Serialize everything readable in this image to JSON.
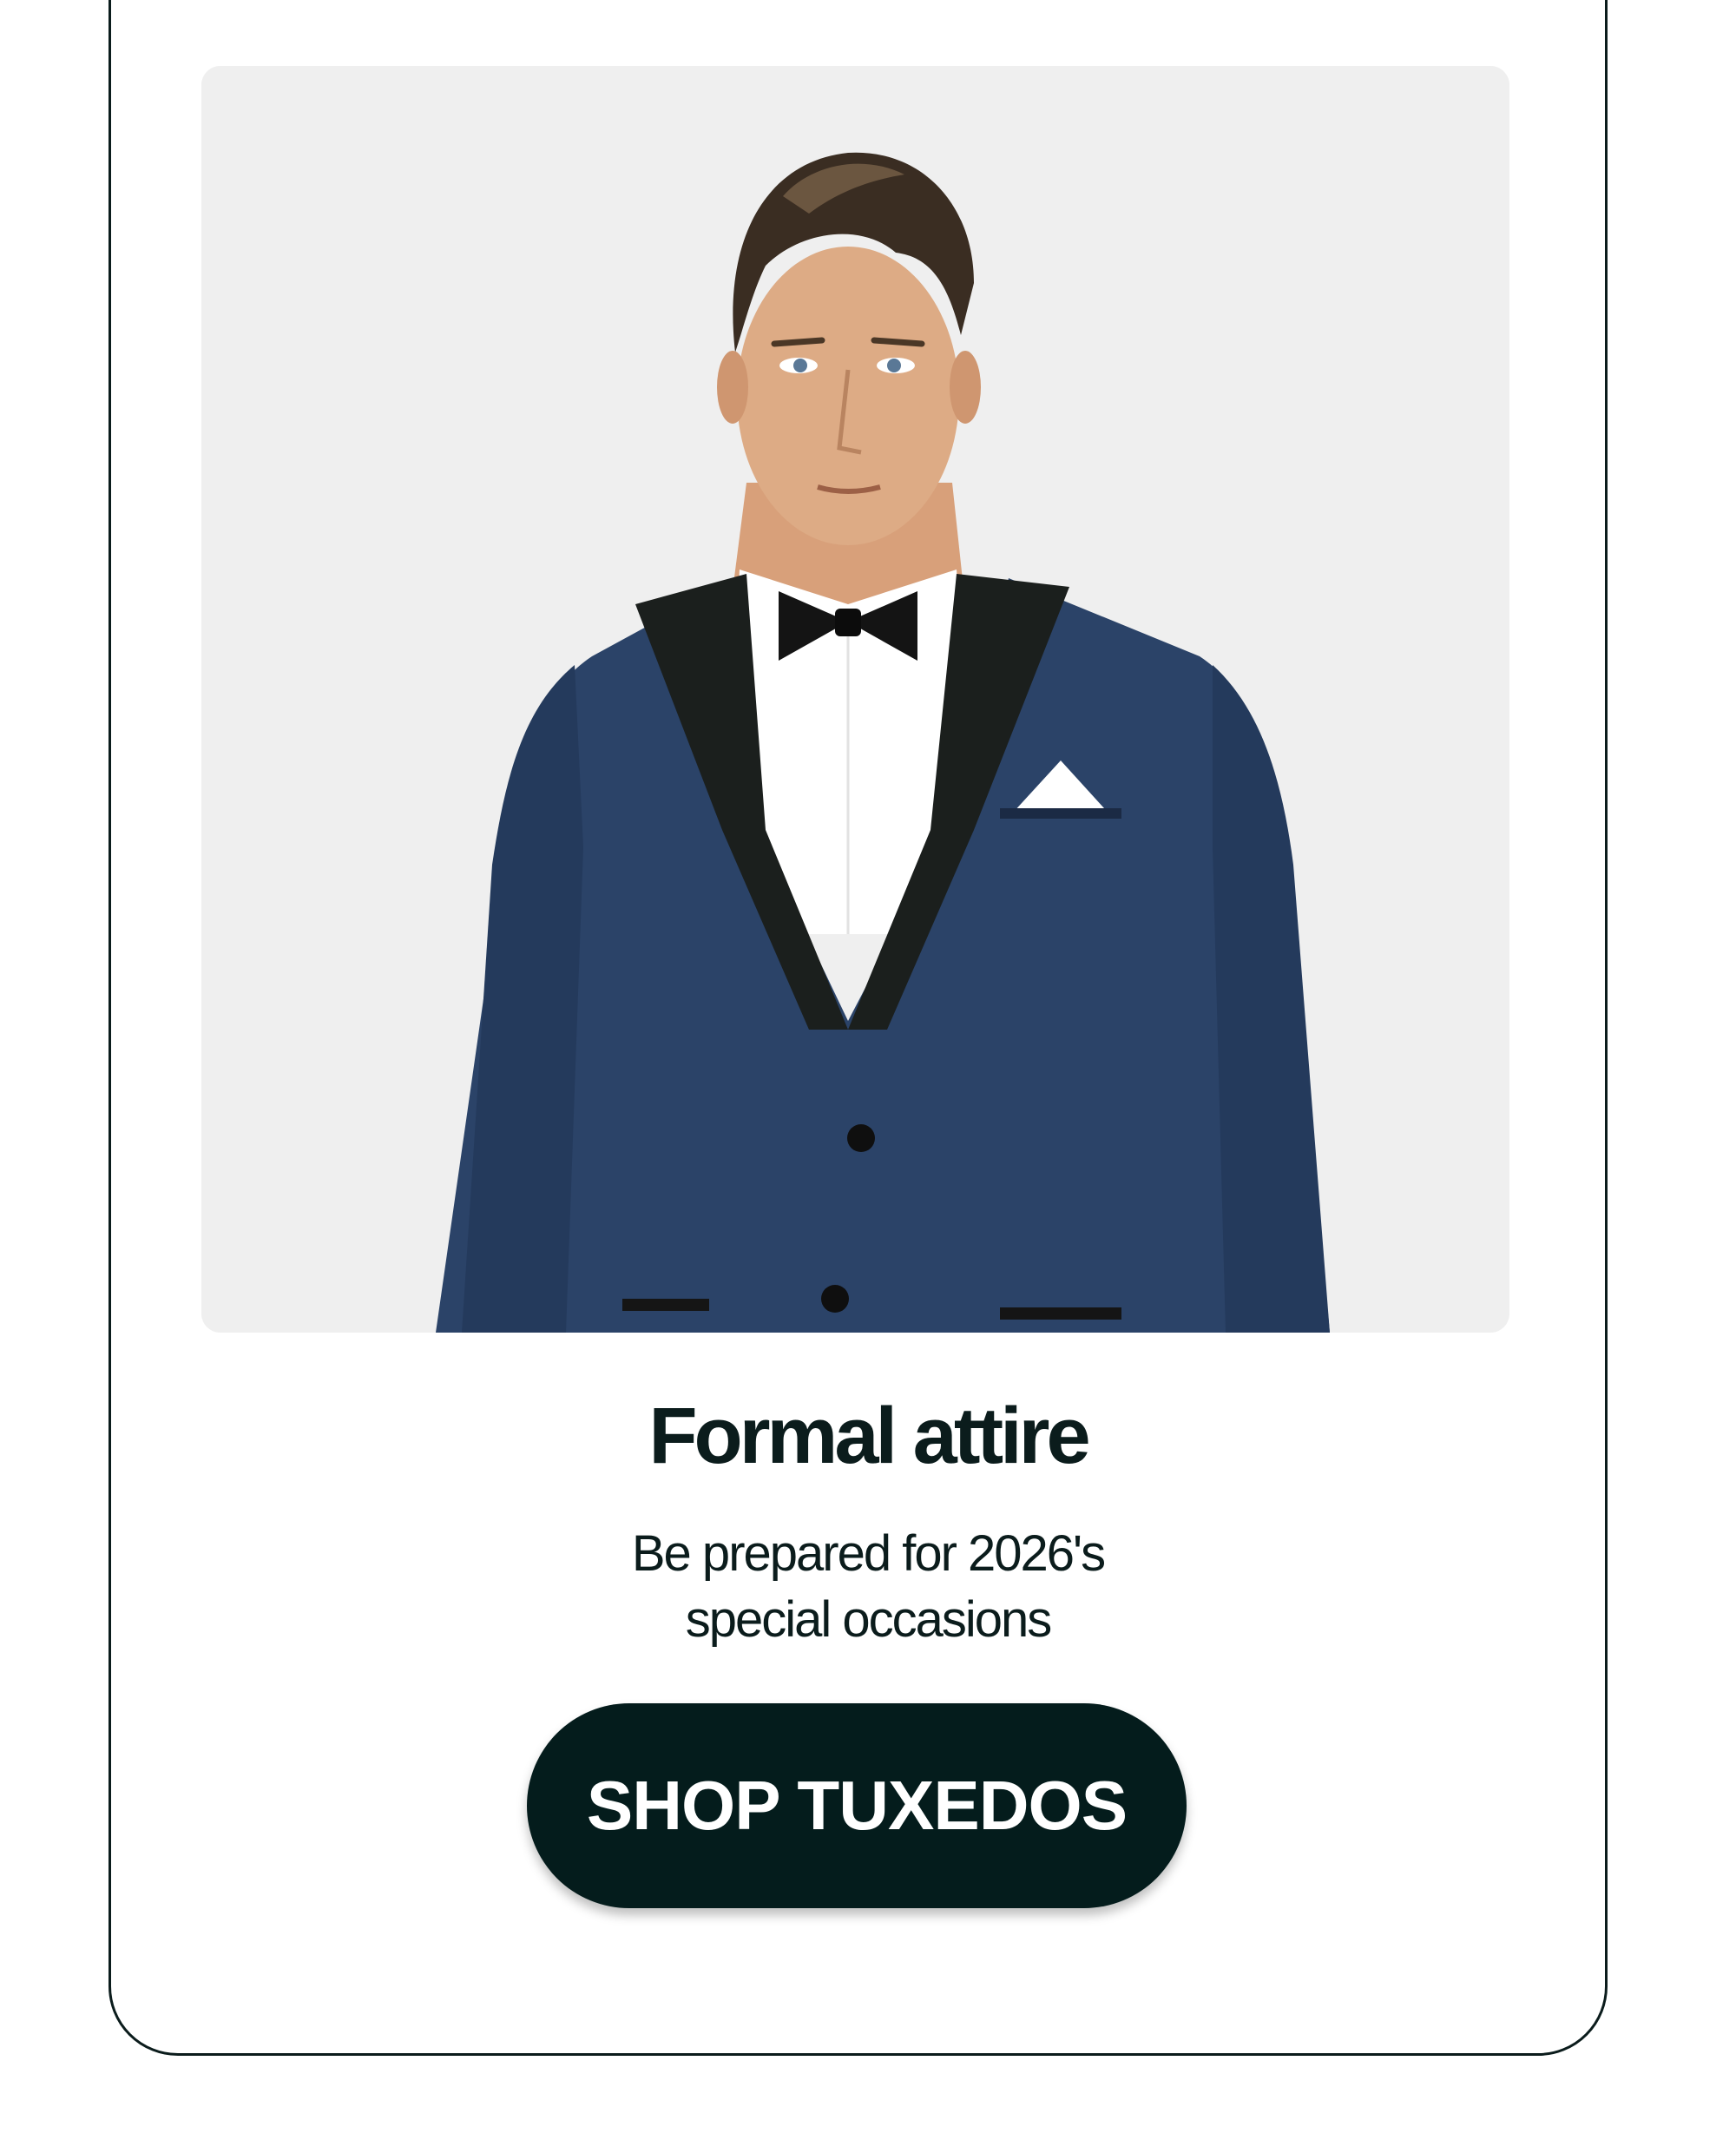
{
  "promo": {
    "title": "Formal attire",
    "subtitle_line1": "Be prepared for 2026's",
    "subtitle_line2": "special occasions",
    "cta_label": "SHOP TUXEDOS"
  },
  "colors": {
    "button_bg": "#041c1c",
    "text": "#0b1c1c",
    "jacket": "#2b4368",
    "lapel": "#1b1f1d",
    "photo_bg": "#efefef"
  }
}
